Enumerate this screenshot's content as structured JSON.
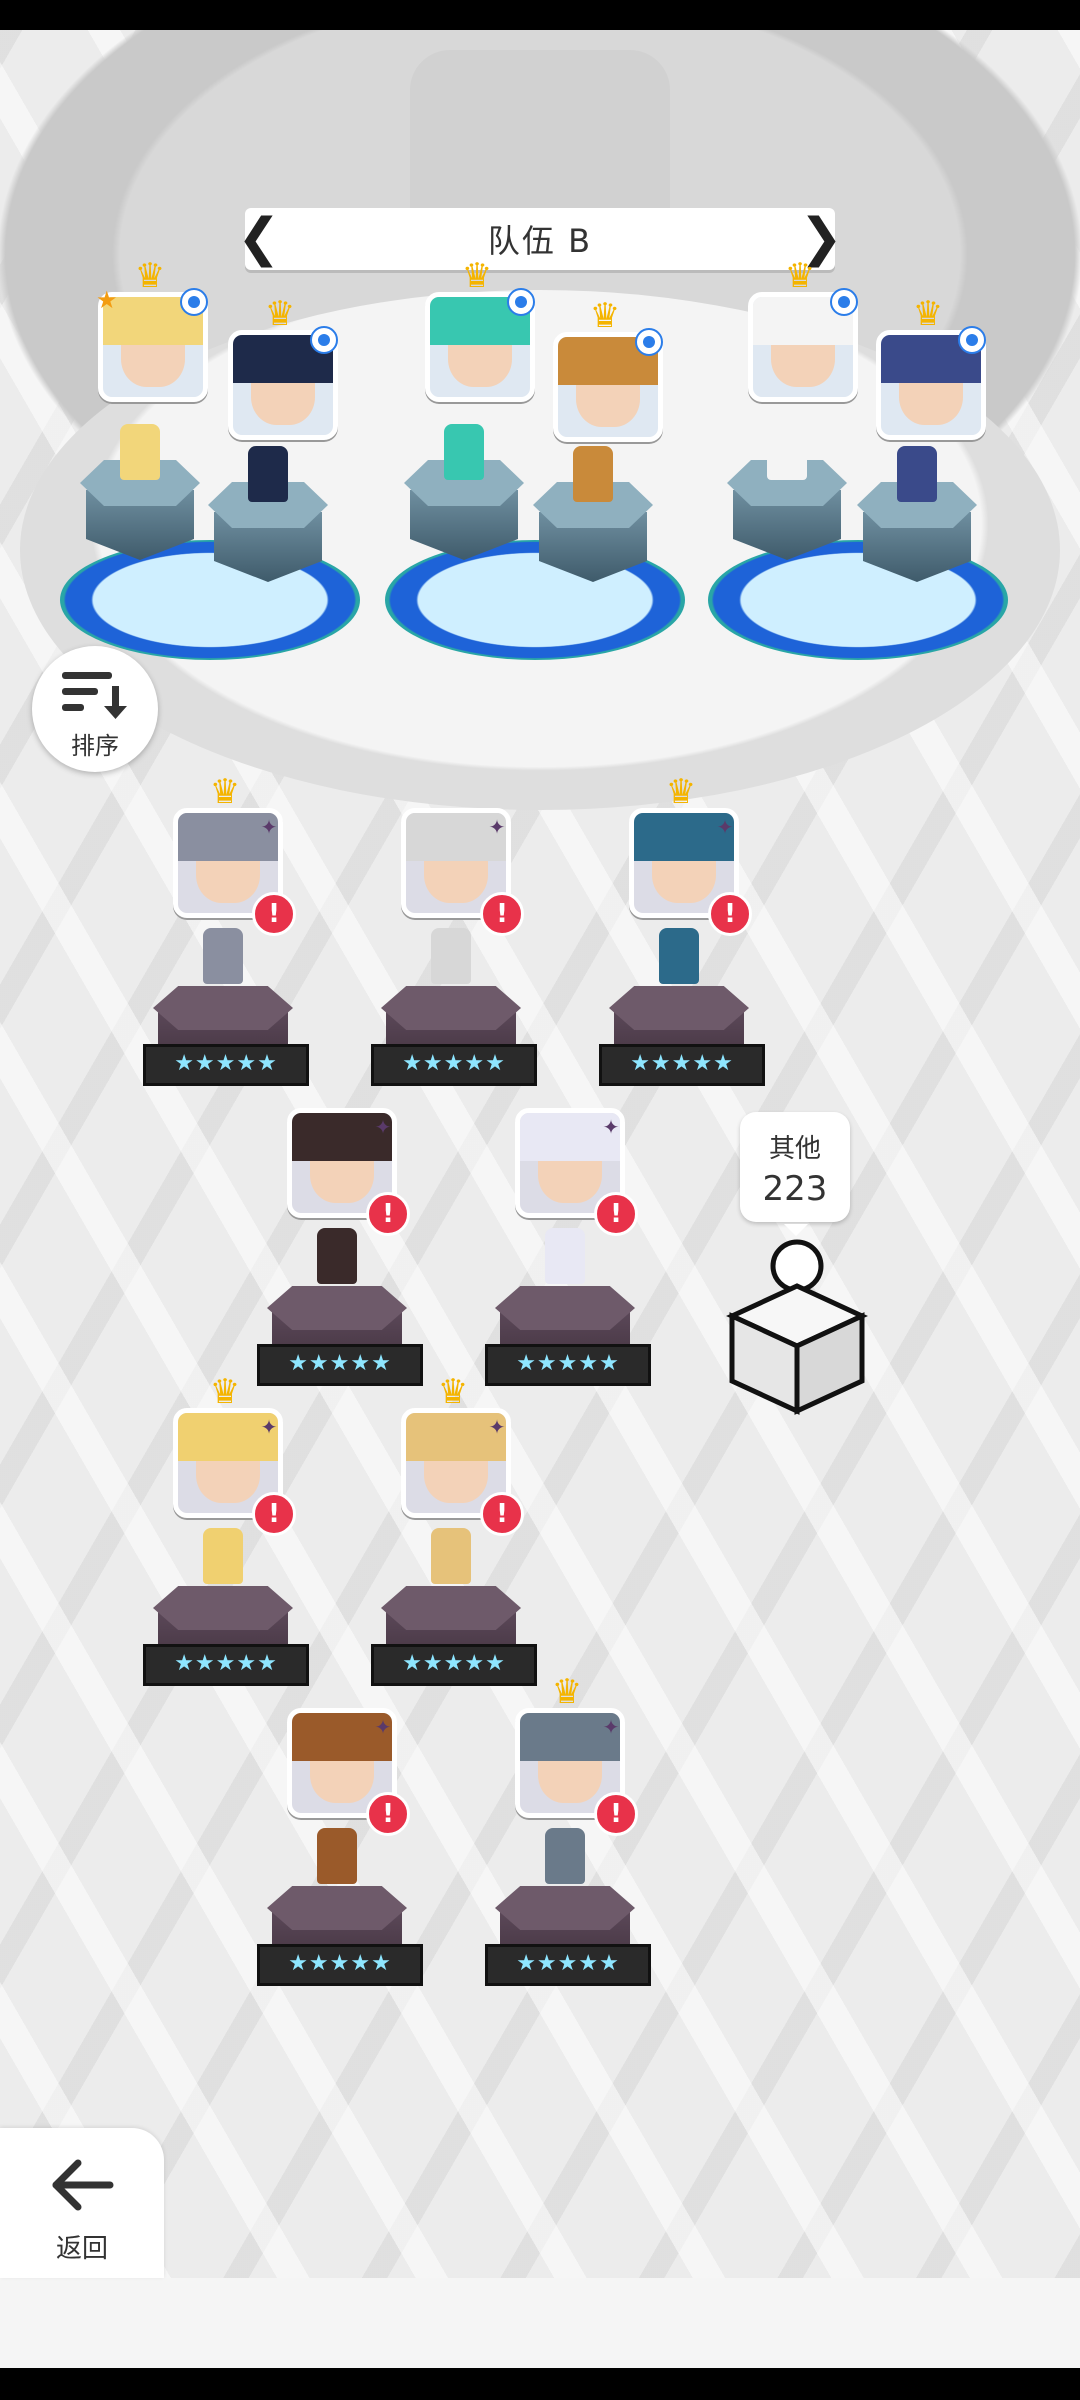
{
  "team": {
    "title": "队伍 B",
    "prev_icon": "chevron-left-icon",
    "next_icon": "chevron-right-icon"
  },
  "sort": {
    "label": "排序",
    "icon": "sort-descending-icon"
  },
  "back": {
    "label": "返回",
    "icon": "arrow-left-icon"
  },
  "other": {
    "label": "其他",
    "count": "223"
  },
  "team_members": [
    {
      "crown": true,
      "favorite_star": true,
      "blue_dot": true,
      "hair": "#f2d67a"
    },
    {
      "crown": true,
      "favorite_star": false,
      "blue_dot": true,
      "hair": "#1e2a4a"
    },
    {
      "crown": true,
      "favorite_star": false,
      "blue_dot": true,
      "hair": "#38c7b0"
    },
    {
      "crown": true,
      "favorite_star": false,
      "blue_dot": true,
      "hair": "#c98a3a"
    },
    {
      "crown": true,
      "favorite_star": false,
      "blue_dot": true,
      "hair": "#f4f4f4"
    },
    {
      "crown": true,
      "favorite_star": false,
      "blue_dot": true,
      "hair": "#3a4a8a"
    }
  ],
  "roster": [
    {
      "crown": true,
      "alert": "!",
      "stars": "★★★★★",
      "hair": "#8a8fa0"
    },
    {
      "crown": false,
      "alert": "!",
      "stars": "★★★★★",
      "hair": "#d7d7d7"
    },
    {
      "crown": true,
      "alert": "!",
      "stars": "★★★★★",
      "hair": "#2c6a8a"
    },
    {
      "crown": false,
      "alert": "!",
      "stars": "★★★★★",
      "hair": "#3a2a2a"
    },
    {
      "crown": false,
      "alert": "!",
      "stars": "★★★★★",
      "hair": "#e8e8f4"
    },
    {
      "crown": true,
      "alert": "!",
      "stars": "★★★★★",
      "hair": "#f0d070"
    },
    {
      "crown": true,
      "alert": "!",
      "stars": "★★★★★",
      "hair": "#e6c27a"
    },
    {
      "crown": false,
      "alert": "!",
      "stars": "★★★★★",
      "hair": "#9a5a2a"
    },
    {
      "crown": true,
      "alert": "!",
      "stars": "★★★★★",
      "hair": "#6a7a8a"
    }
  ],
  "colors": {
    "crown": "#f4b400",
    "alert": "#e8324a",
    "pool_blue": "#1e63d8",
    "pedestal": "#6e5a6a"
  }
}
